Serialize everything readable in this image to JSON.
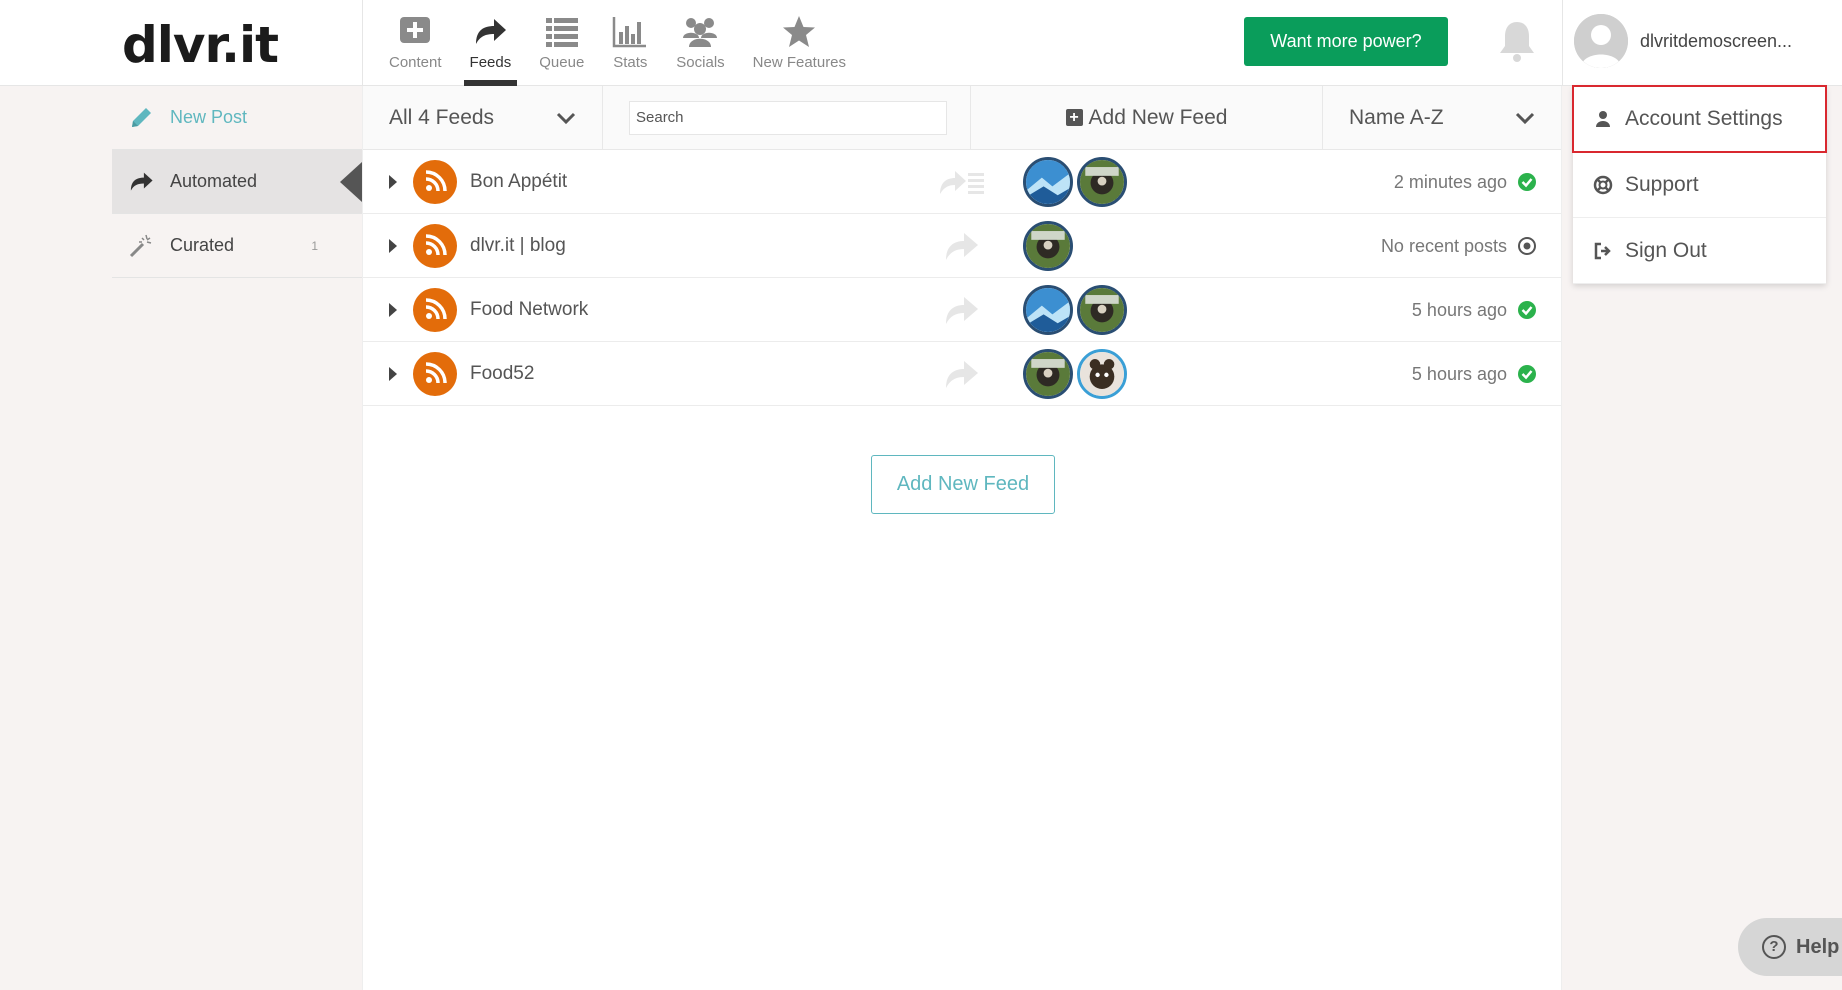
{
  "app": {
    "logo": "dlvr.it"
  },
  "nav": {
    "items": [
      {
        "label": "Content",
        "icon": "add-content-icon"
      },
      {
        "label": "Feeds",
        "icon": "share-arrow-icon",
        "active": true
      },
      {
        "label": "Queue",
        "icon": "list-icon"
      },
      {
        "label": "Stats",
        "icon": "bar-chart-icon"
      },
      {
        "label": "Socials",
        "icon": "people-icon"
      },
      {
        "label": "New Features",
        "icon": "star-icon"
      }
    ]
  },
  "header": {
    "power_button": "Want more power?",
    "username": "dlvritdemoscreen..."
  },
  "sidebar": {
    "items": [
      {
        "label": "New Post",
        "icon": "pencil-icon"
      },
      {
        "label": "Automated",
        "icon": "share-arrow-icon",
        "active": true
      },
      {
        "label": "Curated",
        "icon": "magic-wand-icon",
        "count": "1"
      }
    ]
  },
  "toolbar": {
    "feeds_filter": "All 4 Feeds",
    "search_placeholder": "Search",
    "add_feed": "Add New Feed",
    "sort": "Name A-Z"
  },
  "feeds": [
    {
      "name": "Bon Appétit",
      "status": "2 minutes ago",
      "status_type": "ok",
      "socials": [
        "blue",
        "dark"
      ]
    },
    {
      "name": "dlvr.it | blog",
      "status": "No recent posts",
      "status_type": "idle",
      "socials": [
        "dark"
      ]
    },
    {
      "name": "Food Network",
      "status": "5 hours ago",
      "status_type": "ok",
      "socials": [
        "blue",
        "dark"
      ]
    },
    {
      "name": "Food52",
      "status": "5 hours ago",
      "status_type": "ok",
      "socials": [
        "dark",
        "teal"
      ]
    }
  ],
  "main": {
    "add_feed_button": "Add New Feed"
  },
  "dropdown": {
    "items": [
      {
        "label": "Account Settings",
        "icon": "user-icon"
      },
      {
        "label": "Support",
        "icon": "lifebuoy-icon"
      },
      {
        "label": "Sign Out",
        "icon": "sign-out-icon"
      }
    ]
  },
  "help": {
    "label": "Help"
  },
  "colors": {
    "accent_teal": "#5fb7bf",
    "power_green": "#0a9d5b",
    "rss_orange": "#e36c0a",
    "status_green": "#2bb24c",
    "highlight_red": "#d9282f"
  }
}
